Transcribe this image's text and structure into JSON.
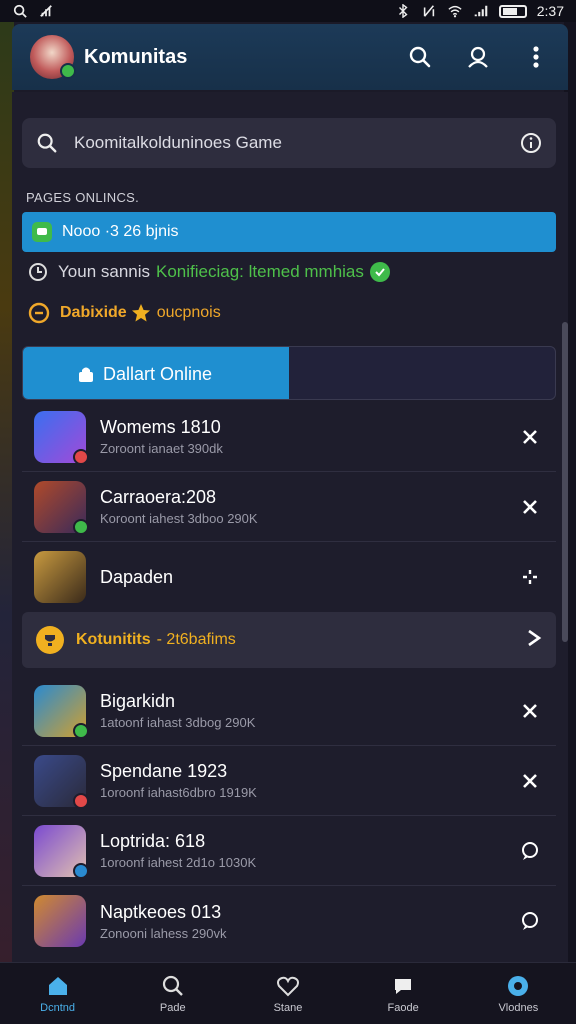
{
  "status_bar": {
    "time": "2:37"
  },
  "header": {
    "title": "Komunitas"
  },
  "search": {
    "placeholder": "Koomitalkolduninoes Game"
  },
  "section_label": "PAGES ONLINCS.",
  "notice": {
    "text": "Nooo ·3 26 bjnis"
  },
  "status_line": {
    "label": "Youn sannis",
    "value": "Konifieciag: ltemed mmhias"
  },
  "points_line": {
    "label": "Dabixide",
    "value": "oucpnois"
  },
  "online_tab": {
    "label": "Dallart Online"
  },
  "games": [
    {
      "title": "Womems 1810",
      "subtitle": "Zoroont ianaet 390dk",
      "badge": "#e24848",
      "colors": [
        "#3a6ff0",
        "#a24ad8"
      ]
    },
    {
      "title": "Carraoera:208",
      "subtitle": "Koroont iahest 3dboo 290K",
      "badge": "#3fba4a",
      "colors": [
        "#b04a2a",
        "#3a2a5a"
      ]
    },
    {
      "title": "Dapaden",
      "subtitle": "",
      "badge": "",
      "colors": [
        "#c89a40",
        "#3a2a1a"
      ]
    }
  ],
  "group": {
    "title": "Kotunitits",
    "count": "- 2t6bafims"
  },
  "games2": [
    {
      "title": "Bigarkidn",
      "subtitle": "1atoonf iahast 3dbog 290K",
      "badge": "#3fba4a",
      "colors": [
        "#2a8ad0",
        "#d0a030"
      ]
    },
    {
      "title": "Spendane 1923",
      "subtitle": "1oroonf iahast6dbro 1919K",
      "badge": "#e24848",
      "colors": [
        "#3a4a8a",
        "#2a2a3a"
      ]
    },
    {
      "title": "Loptrida: 618",
      "subtitle": "1oroonf iahest 2d1o 1030K",
      "badge": "#2a8ad0",
      "colors": [
        "#7a4ad0",
        "#e0c0b0"
      ]
    },
    {
      "title": "Naptkeoes 013",
      "subtitle": "Zonooni lahess 290vk",
      "badge": "",
      "colors": [
        "#d08a30",
        "#6a3ab0"
      ]
    }
  ],
  "nav": [
    {
      "label": "Dcntnd",
      "icon": "home-icon"
    },
    {
      "label": "Pade",
      "icon": "search-icon"
    },
    {
      "label": "Stane",
      "icon": "heart-icon"
    },
    {
      "label": "Faode",
      "icon": "chat-icon"
    },
    {
      "label": "Vlodnes",
      "icon": "profile-icon"
    }
  ]
}
